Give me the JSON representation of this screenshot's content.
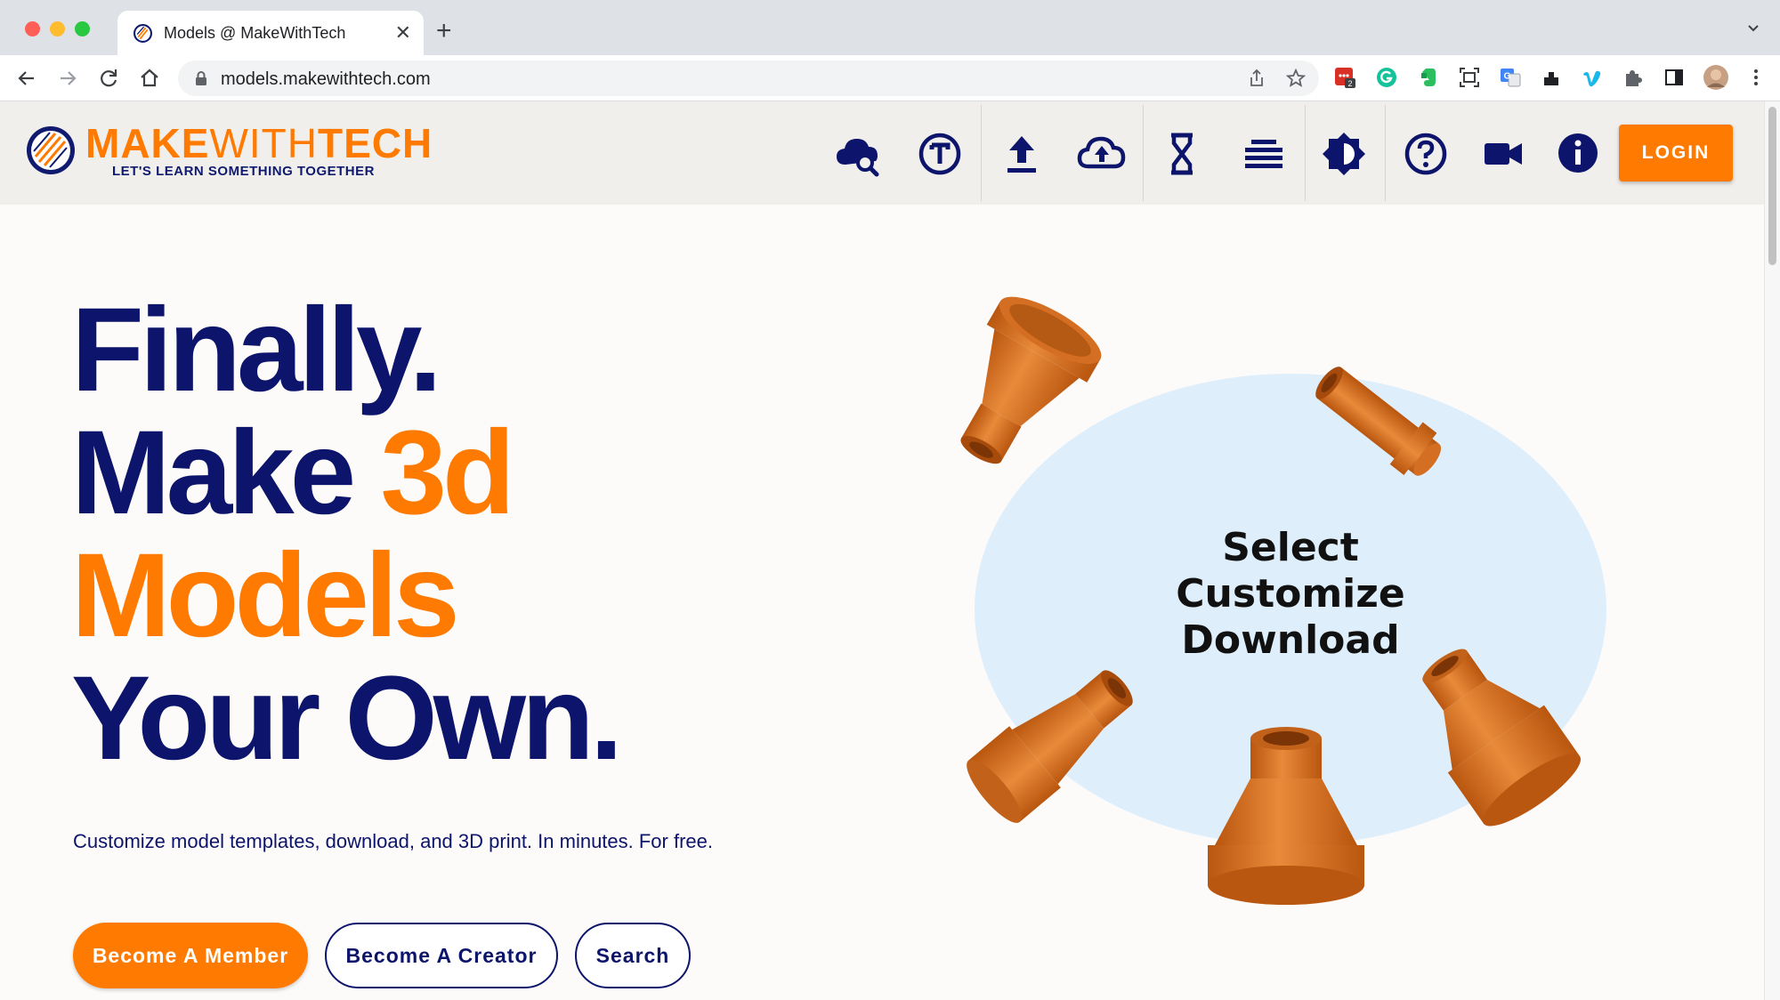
{
  "browser": {
    "tab_title": "Models @ MakeWithTech",
    "new_tab": "+",
    "close": "✕",
    "url": "models.makewithtech.com",
    "extension_badge": "2"
  },
  "site": {
    "logo_make": "MAKE",
    "logo_with": "WITH",
    "logo_tech": "TECH",
    "tagline": "LET'S LEARN SOMETHING TOGETHER",
    "login_label": "LOGIN",
    "nav_icons": [
      "cloud-search-icon",
      "text-t-icon",
      "upload-icon",
      "cloud-upload-icon",
      "hourglass-icon",
      "list-icon",
      "brightness-icon",
      "help-icon",
      "video-icon",
      "info-icon"
    ]
  },
  "hero": {
    "line1": "Finally.",
    "line2_a": "Make ",
    "line2_b": "3d",
    "line3": "Models",
    "line4": "Your Own.",
    "subtitle": "Customize model templates, download, and 3D print. In minutes. For free.",
    "btn_member": "Become A Member",
    "btn_creator": "Become A Creator",
    "btn_search": "Search",
    "illustration_words": [
      "Select",
      "Customize",
      "Download"
    ]
  },
  "colors": {
    "navy": "#0c146b",
    "orange": "#ff7a00",
    "blob": "#deeefb",
    "part": "#e07524"
  }
}
